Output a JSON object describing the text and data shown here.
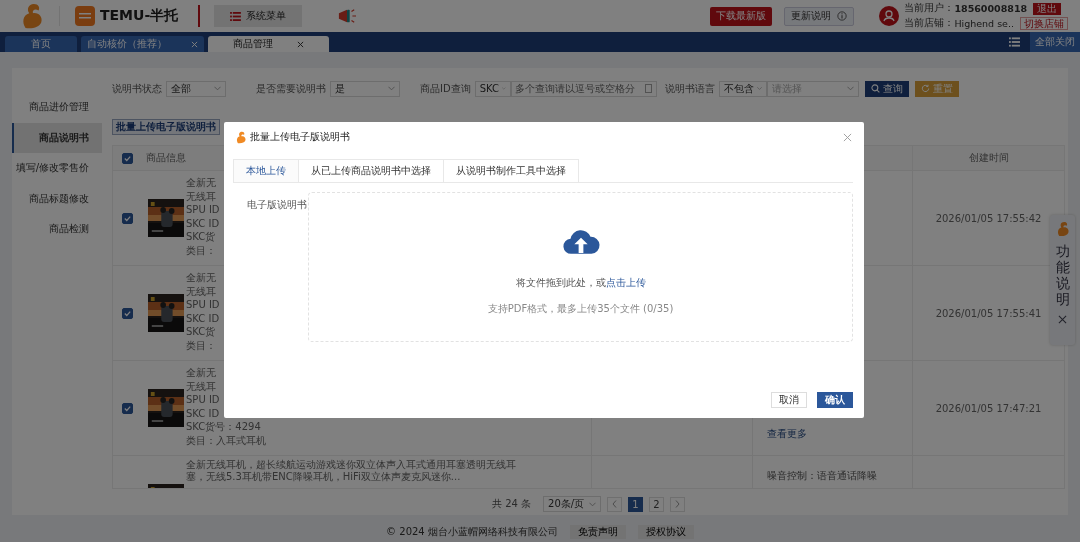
{
  "header": {
    "app_name": "TEMU-半托",
    "menu_button": "系统菜单",
    "download_button": "下载最新版",
    "update_button": "更新说明",
    "user_label": "当前用户：",
    "user": "18560008818",
    "logout_button": "退出",
    "shop_label": "当前店铺：",
    "shop": "Highend se..",
    "switch_shop_button": "切换店铺"
  },
  "tabs": [
    {
      "label": "首页",
      "closable": false,
      "selected": false
    },
    {
      "label": "自动核价（推荐）",
      "closable": true,
      "selected": false
    },
    {
      "label": "商品管理",
      "closable": true,
      "selected": true
    }
  ],
  "close_all_button": "全部关闭",
  "sidebar": {
    "items": [
      {
        "label": "商品进价管理",
        "selected": false
      },
      {
        "label": "商品说明书",
        "selected": true
      },
      {
        "label": "填写/修改零售价",
        "selected": false
      },
      {
        "label": "商品标题修改",
        "selected": false
      },
      {
        "label": "商品检测",
        "selected": false
      }
    ]
  },
  "filters": {
    "status": {
      "label": "说明书状态",
      "value": "全部"
    },
    "need_manual": {
      "label": "是否需要说明书",
      "value": "是"
    },
    "id_query": {
      "label": "商品ID查询",
      "type": "SKC",
      "placeholder": "多个查询请以逗号或空格分"
    },
    "language": {
      "label": "说明书语言",
      "mode": "不包含",
      "placeholder": "请选择"
    },
    "search_button": "查询",
    "reset_button": "重置"
  },
  "bulk_upload_button": "批量上传电子版说明书",
  "table": {
    "all_checked": true,
    "columns": [
      {
        "header": "商品信息"
      },
      {
        "header": "创建时间"
      }
    ],
    "rows": [
      {
        "checked": true,
        "lines": [
          "全新无",
          "无线耳",
          "SPU ID",
          "SKC ID",
          "SKC货",
          "类目："
        ],
        "details": [],
        "created": "2026/01/05 17:55:42"
      },
      {
        "checked": true,
        "lines": [
          "全新无",
          "无线耳",
          "SPU ID",
          "SKC ID",
          "SKC货",
          "类目："
        ],
        "details": [],
        "created": "2026/01/05 17:55:41"
      },
      {
        "checked": true,
        "lines": [
          "全新无",
          "无线耳",
          "SPU ID",
          "SKC ID",
          "SKC货号：4294",
          "类目：入耳式耳机"
        ],
        "details": [
          {
            "text": "查看更多",
            "kind": "link"
          }
        ],
        "created": "2026/01/05 17:47:21"
      },
      {
        "lines": [
          "全新无线耳机，超长续航运动游戏迷你双立体声入耳式通用耳塞透明无线耳塞，无线5.3耳机带ENC降噪耳机，HiFi双立体声麦克风迷你..."
        ],
        "details": [
          {
            "text": "噪音控制：语音通话降噪",
            "kind": "text"
          }
        ]
      }
    ]
  },
  "pagination": {
    "total": "共 24 条",
    "page_size": "20条/页",
    "pages": [
      {
        "label": "1",
        "selected": true
      },
      {
        "label": "2",
        "selected": false
      }
    ]
  },
  "footer": {
    "copyright": "© 2024 烟台小蓝帽网络科技有限公司",
    "links": [
      "免责声明",
      "授权协议"
    ]
  },
  "help_panel": {
    "label": "功能说明"
  },
  "dialog": {
    "title": "批量上传电子版说明书",
    "tabs": [
      {
        "label": "本地上传",
        "selected": true
      },
      {
        "label": "从已上传商品说明书中选择",
        "selected": false
      },
      {
        "label": "从说明书制作工具中选择",
        "selected": false
      }
    ],
    "field_label": "电子版说明书",
    "drop_text": "将文件拖到此处，或",
    "upload_link": "点击上传",
    "hint": "支持PDF格式，最多上传35个文件 (0/35)",
    "buttons": [
      {
        "label": "取消",
        "kind": "secondary"
      },
      {
        "label": "确认",
        "kind": "primary"
      }
    ]
  }
}
